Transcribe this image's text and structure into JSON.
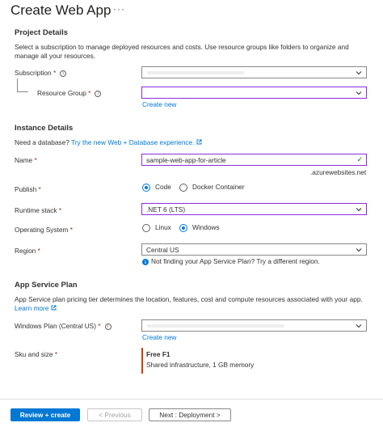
{
  "header": {
    "title": "Create Web App",
    "more": "···"
  },
  "project": {
    "heading": "Project Details",
    "description": "Select a subscription to manage deployed resources and costs. Use resource groups like folders to organize and manage all your resources.",
    "subscription_label": "Subscription",
    "resource_group_label": "Resource Group",
    "create_new": "Create new"
  },
  "instance": {
    "heading": "Instance Details",
    "db_prompt": "Need a database?",
    "db_link": "Try the new Web + Database experience.",
    "name_label": "Name",
    "name_value": "sample-web-app-for-article",
    "domain_suffix": ".azurewebsites.net",
    "publish_label": "Publish",
    "publish_options": [
      "Code",
      "Docker Container"
    ],
    "publish_selected": "Code",
    "runtime_label": "Runtime stack",
    "runtime_value": ".NET 6 (LTS)",
    "os_label": "Operating System",
    "os_options": [
      "Linux",
      "Windows"
    ],
    "os_selected": "Windows",
    "region_label": "Region",
    "region_value": "Central US",
    "region_hint": "Not finding your App Service Plan? Try a different region."
  },
  "plan": {
    "heading": "App Service Plan",
    "description": "App Service plan pricing tier determines the location, features, cost and compute resources associated with your app.",
    "learn_more": "Learn more",
    "windows_plan_label": "Windows Plan (Central US)",
    "create_new": "Create new",
    "sku_label": "Sku and size",
    "sku_name": "Free F1",
    "sku_detail": "Shared infrastructure, 1 GB memory"
  },
  "footer": {
    "review_create": "Review + create",
    "previous": "< Previous",
    "next": "Next : Deployment >"
  },
  "colors": {
    "accent": "#0078d4",
    "required": "#a4262c",
    "focus_border": "#8a2be2",
    "sku_bar": "#d83b01",
    "valid": "#107c10"
  }
}
